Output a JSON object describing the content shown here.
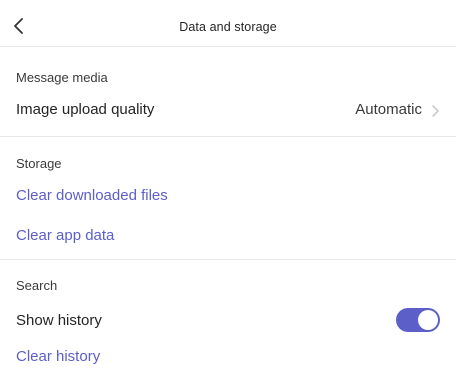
{
  "header": {
    "title": "Data and storage",
    "back_icon": "chevron-left-icon"
  },
  "sections": {
    "message_media": {
      "label": "Message media",
      "image_upload_quality": {
        "label": "Image upload quality",
        "value": "Automatic",
        "icon": "chevron-right-icon"
      }
    },
    "storage": {
      "label": "Storage",
      "clear_downloaded_files": "Clear downloaded files",
      "clear_app_data": "Clear app data"
    },
    "search": {
      "label": "Search",
      "show_history": {
        "label": "Show history",
        "enabled": true
      },
      "clear_history": "Clear history"
    }
  },
  "colors": {
    "accent": "#5b5fc7",
    "divider": "#e9e9e9",
    "text": "#242424"
  }
}
